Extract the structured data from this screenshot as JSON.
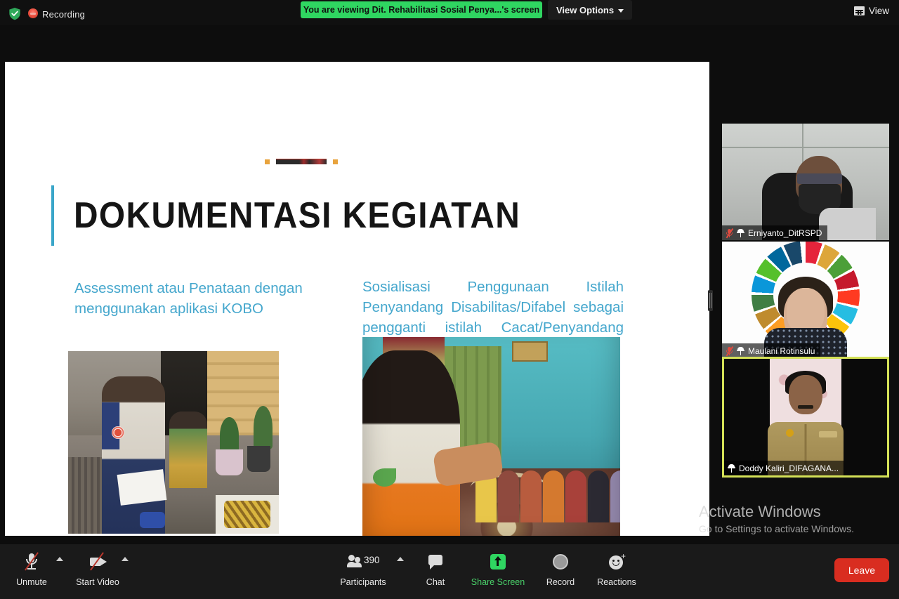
{
  "topbar": {
    "encryption_icon": "shield-check-icon",
    "recording_icon": "recording-dot-icon",
    "recording_label": "Recording",
    "viewing_notice": "You are viewing Dit. Rehabilitasi Sosial Penya...'s screen",
    "view_options_label": "View Options",
    "view_options_caret": "chevron-down-icon",
    "view_button_label": "View",
    "view_button_icon": "grid-view-icon",
    "accent_green": "#2fd661"
  },
  "shared_screen": {
    "slide_title": "DOKUMENTASI KEGIATAN",
    "caption_left": "Assessment atau Penataan dengan menggunakan aplikasi KOBO",
    "caption_right": "Sosialisasi Penggunaan Istilah Penyandang Disabilitas/Difabel sebagai pengganti istilah Cacat/Penyandang Cacat",
    "caption_color": "#45a7cd",
    "title_rule_color": "#3aa6c9",
    "decor_square_color": "#e8a33d",
    "photo_left_alt": "field-officer-assessment-photo",
    "photo_right_alt": "community-socialization-photo"
  },
  "participants": [
    {
      "name": "Erniyanto_DitRSPD",
      "muted": true,
      "pinned": true,
      "active_speaker": false
    },
    {
      "name": "Maulani Rotinsulu",
      "muted": true,
      "pinned": true,
      "active_speaker": false
    },
    {
      "name": "Doddy Kaliri_DIFAGANA...",
      "muted": false,
      "pinned": true,
      "active_speaker": true,
      "border_color": "#d4e157"
    }
  ],
  "watermark": {
    "line1": "Activate Windows",
    "line2": "Go to Settings to activate Windows."
  },
  "toolbar": {
    "unmute_label": "Unmute",
    "unmute_icon": "microphone-muted-icon",
    "start_video_label": "Start Video",
    "start_video_icon": "camera-off-icon",
    "participants_label": "Participants",
    "participants_icon": "people-icon",
    "participants_count": "390",
    "chat_label": "Chat",
    "chat_icon": "chat-bubble-icon",
    "share_screen_label": "Share Screen",
    "share_screen_icon": "share-screen-icon",
    "record_label": "Record",
    "record_icon": "record-circle-icon",
    "reactions_label": "Reactions",
    "reactions_icon": "smiley-reactions-icon",
    "leave_label": "Leave",
    "leave_color": "#d92d20",
    "share_green": "#4ad16a"
  }
}
